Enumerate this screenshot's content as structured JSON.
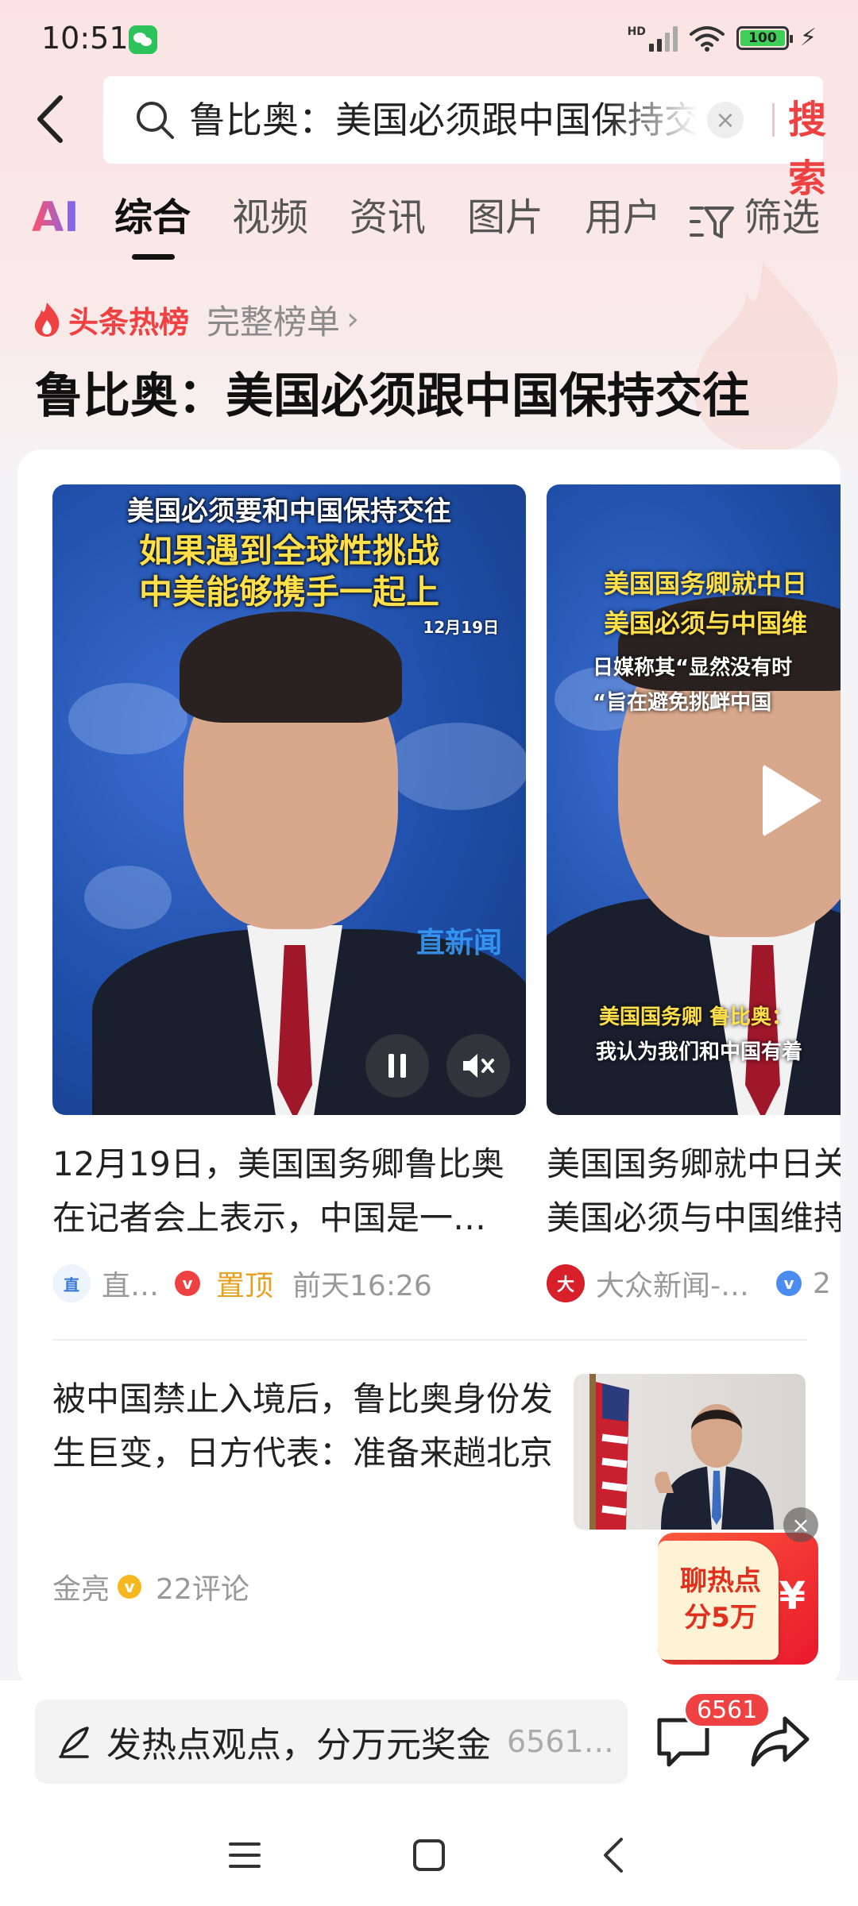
{
  "status_bar": {
    "time": "10:51",
    "battery": "100",
    "network": "HD"
  },
  "search": {
    "query": "鲁比奥：美国必须跟中国保持交往",
    "clear_symbol": "×",
    "button_label": "搜索"
  },
  "tabs": [
    {
      "label": "AI"
    },
    {
      "label": "综合",
      "active": true
    },
    {
      "label": "视频"
    },
    {
      "label": "资讯"
    },
    {
      "label": "图片"
    },
    {
      "label": "用户"
    },
    {
      "label": "筛选"
    }
  ],
  "hot_list": {
    "label": "头条热榜",
    "link": "完整榜单",
    "chevron": "›",
    "headline": "鲁比奥：美国必须跟中国保持交往"
  },
  "videos": [
    {
      "caption_line1": "美国必须要和中国保持交往",
      "caption_line2": "如果遇到全球性挑战",
      "caption_line3": "中美能够携手一起上",
      "caption_date": "12月19日",
      "watermark": "直新闻",
      "title": "12月19日，美国国务卿鲁比奥在记者会上表示，中国是一…",
      "source": "直…",
      "source_logo": "直",
      "badge": "v",
      "tag": "置顶",
      "time": "前天16:26"
    },
    {
      "caption_line1": "美国国务卿就中日",
      "caption_line2": "美国必须与中国维",
      "caption_line3": "日媒称其“显然没有时",
      "caption_line4": "“旨在避免挑衅中国",
      "bottom_caption1": "美国国务卿 鲁比奥：",
      "bottom_caption2": "我认为我们和中国有着",
      "title_line1": "美国国务卿就中日关",
      "title_line2": "美国必须与中国维持",
      "source": "大众新闻-…",
      "badge": "v",
      "extra": "2"
    }
  ],
  "article": {
    "title": "被中国禁止入境后，鲁比奥身份发生巨变，日方代表：准备来趟北京",
    "author": "金亮",
    "badge": "v",
    "comments": "22评论"
  },
  "promo": {
    "line1": "聊热点",
    "line2": "分5万",
    "currency": "¥",
    "close": "×"
  },
  "bottom_bar": {
    "comment_placeholder": "发热点观点，分万元奖金",
    "comment_count_text": "6561…",
    "badge_count": "6561"
  },
  "colors": {
    "accent": "#f04142",
    "pinned": "#e8a020",
    "badge_blue": "#4a8cf0",
    "gold": "#f5b820"
  }
}
